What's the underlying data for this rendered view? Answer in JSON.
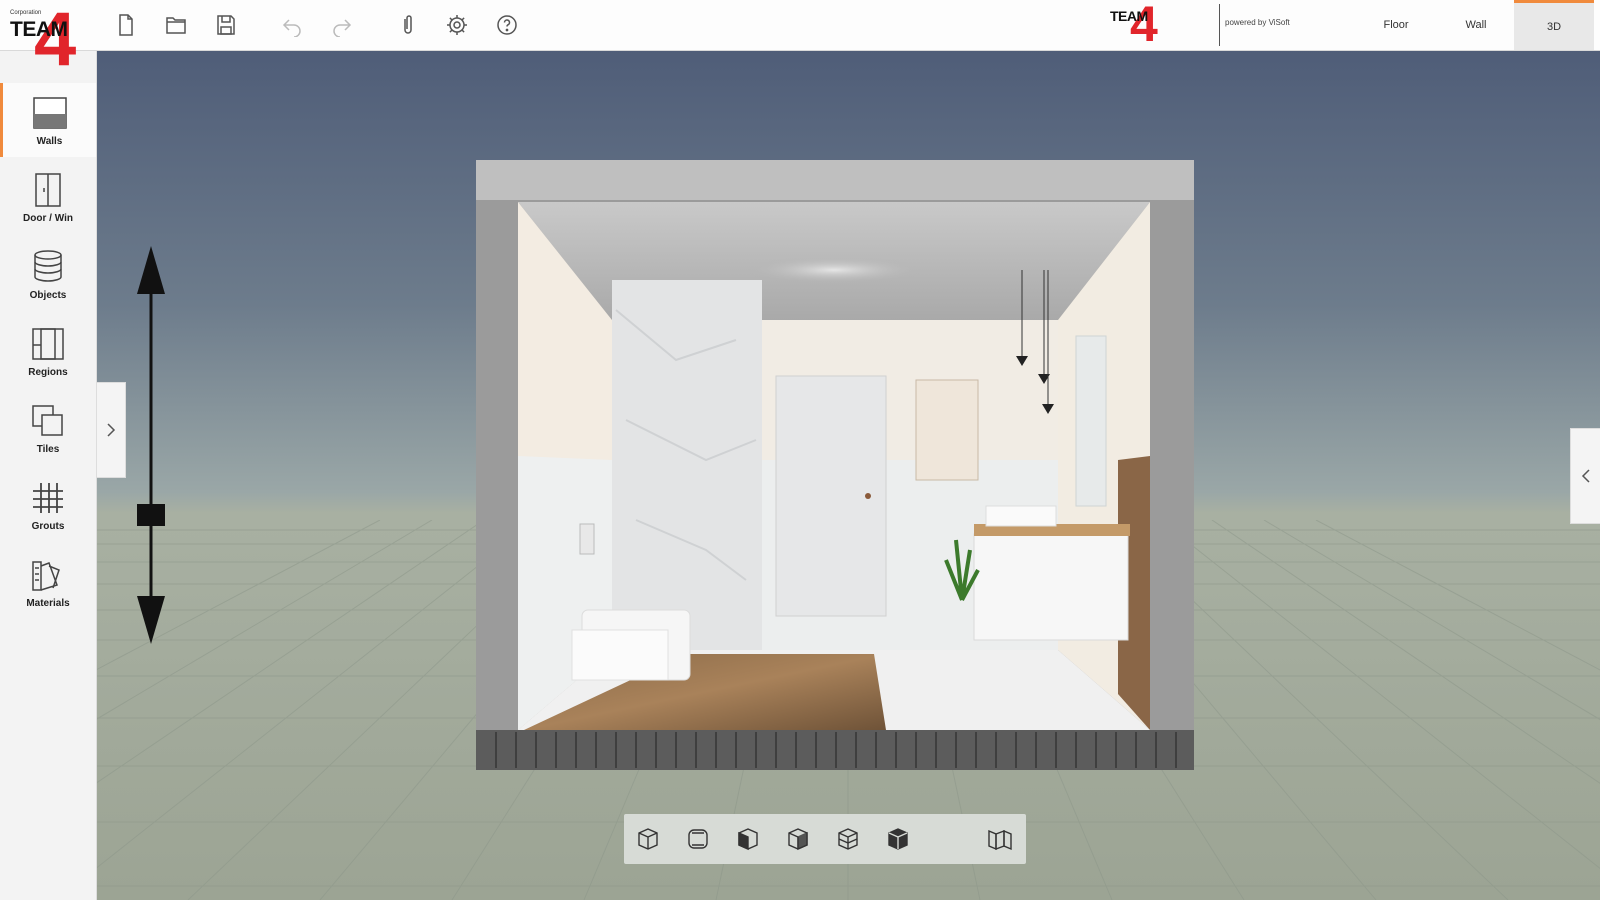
{
  "brand": {
    "small_text": "Corporation",
    "team_text": "TEAM",
    "four_text": "4",
    "logo_color": "#e1252b"
  },
  "toolbar": {
    "buttons": [
      {
        "name": "new-file",
        "icon": "file-icon"
      },
      {
        "name": "open-folder",
        "icon": "folder-icon"
      },
      {
        "name": "save",
        "icon": "save-icon"
      },
      {
        "name": "undo",
        "icon": "undo-icon"
      },
      {
        "name": "redo",
        "icon": "redo-icon"
      },
      {
        "name": "attach",
        "icon": "paperclip-icon"
      },
      {
        "name": "settings",
        "icon": "gear-icon"
      },
      {
        "name": "help",
        "icon": "help-icon"
      }
    ],
    "powered_by": "powered by ViSoft",
    "view_tabs": [
      {
        "label": "Floor",
        "active": false
      },
      {
        "label": "Wall",
        "active": false
      },
      {
        "label": "3D",
        "active": true
      }
    ]
  },
  "sidebar": {
    "items": [
      {
        "label": "Walls",
        "icon": "walls-icon",
        "active": true
      },
      {
        "label": "Door / Win",
        "icon": "door-icon",
        "active": false
      },
      {
        "label": "Objects",
        "icon": "objects-icon",
        "active": false
      },
      {
        "label": "Regions",
        "icon": "regions-icon",
        "active": false
      },
      {
        "label": "Tiles",
        "icon": "tiles-icon",
        "active": false
      },
      {
        "label": "Grouts",
        "icon": "grouts-icon",
        "active": false
      },
      {
        "label": "Materials",
        "icon": "materials-icon",
        "active": false
      }
    ]
  },
  "viewport": {
    "left_panel_toggle": "chevron-right-icon",
    "right_panel_toggle": "chevron-left-icon",
    "elevation_slider_level": 0.25,
    "view_modes": [
      "cube-perspective-icon",
      "cube-rounded-icon",
      "cube-front-icon",
      "cube-left-icon",
      "cube-right-icon",
      "cube-top-icon",
      "unfold-walls-icon"
    ]
  },
  "colors": {
    "accent": "#f08a3c",
    "toolbar_bg": "#fdfdfd",
    "sidebar_bg": "#f3f3f3"
  }
}
